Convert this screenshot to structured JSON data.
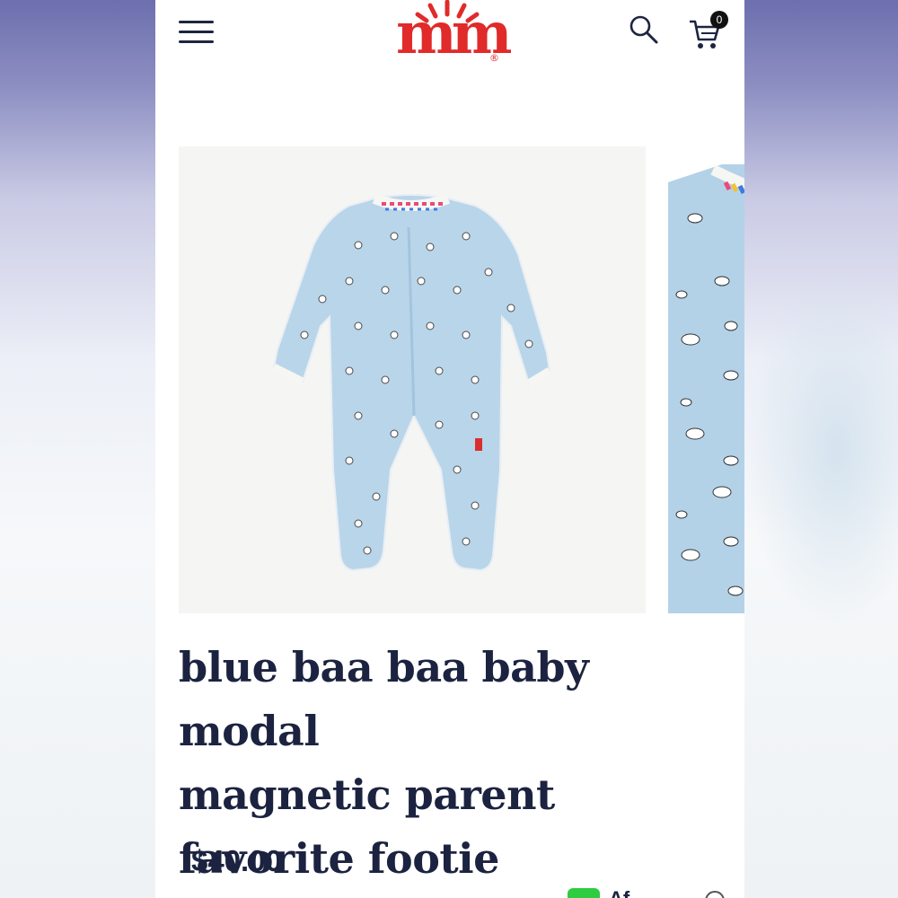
{
  "header": {
    "menu_icon": "hamburger-menu-icon",
    "logo": {
      "text": "m",
      "symbol": "®",
      "color": "#e02b2a"
    },
    "search_icon": "search-icon",
    "cart_icon": "shopping-cart-icon",
    "cart_count": "0"
  },
  "product": {
    "title_lines": [
      "blue baa baa baby modal",
      "magnetic parent",
      "favorite footie"
    ],
    "price": "$40.00",
    "installment_text": "…",
    "afterpay_label": "Af"
  },
  "colors": {
    "brand_red": "#e02b2a",
    "text_navy": "#1c2340",
    "garment_blue": "#a9c9e1",
    "afterpay_green": "#2ecc40"
  }
}
